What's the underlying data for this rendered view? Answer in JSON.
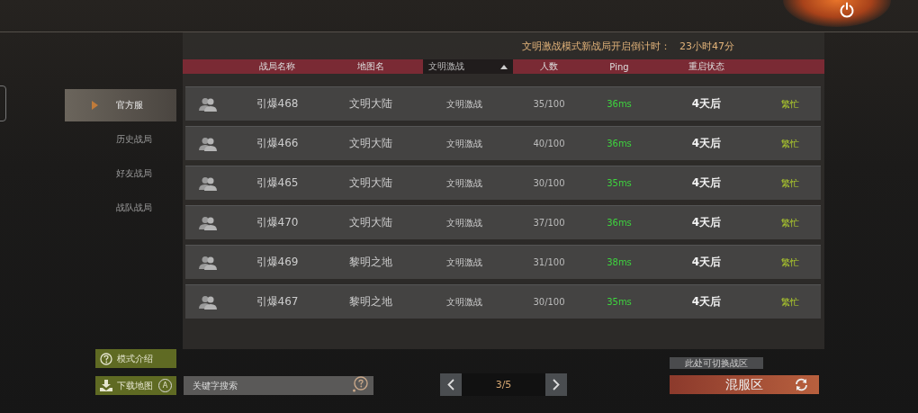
{
  "countdown": {
    "label": "文明激战模式新战局开启倒计时：",
    "value": "23小时47分"
  },
  "sidebar": {
    "items": [
      {
        "label": "官方服",
        "selected": true
      },
      {
        "label": "历史战局",
        "selected": false
      },
      {
        "label": "好友战局",
        "selected": false
      },
      {
        "label": "战队战局",
        "selected": false
      }
    ]
  },
  "table": {
    "columns": [
      {
        "label": "战局名称",
        "kind": "text"
      },
      {
        "label": "地图名",
        "kind": "text"
      },
      {
        "label": "文明激战",
        "kind": "dropdown"
      },
      {
        "label": "人数",
        "kind": "text"
      },
      {
        "label": "Ping",
        "kind": "text"
      },
      {
        "label": "重启状态",
        "kind": "text"
      }
    ],
    "rows": [
      {
        "name": "引爆468",
        "map": "文明大陆",
        "mode": "文明激战",
        "players": "35/100",
        "ping": "36ms",
        "restart": "4天后",
        "status": "繁忙"
      },
      {
        "name": "引爆466",
        "map": "文明大陆",
        "mode": "文明激战",
        "players": "40/100",
        "ping": "36ms",
        "restart": "4天后",
        "status": "繁忙"
      },
      {
        "name": "引爆465",
        "map": "文明大陆",
        "mode": "文明激战",
        "players": "30/100",
        "ping": "35ms",
        "restart": "4天后",
        "status": "繁忙"
      },
      {
        "name": "引爆470",
        "map": "文明大陆",
        "mode": "文明激战",
        "players": "37/100",
        "ping": "36ms",
        "restart": "4天后",
        "status": "繁忙"
      },
      {
        "name": "引爆469",
        "map": "黎明之地",
        "mode": "文明激战",
        "players": "31/100",
        "ping": "38ms",
        "restart": "4天后",
        "status": "繁忙"
      },
      {
        "name": "引爆467",
        "map": "黎明之地",
        "mode": "文明激战",
        "players": "30/100",
        "ping": "35ms",
        "restart": "4天后",
        "status": "繁忙"
      }
    ]
  },
  "mode_intro_button": "模式介绍",
  "download_map_button": {
    "label": "下载地图",
    "key_hint": "A"
  },
  "search": {
    "placeholder": "关键字搜索"
  },
  "pager": {
    "page": "3/5"
  },
  "zone": {
    "tooltip": "此处可切换战区",
    "label": "混服区"
  }
}
